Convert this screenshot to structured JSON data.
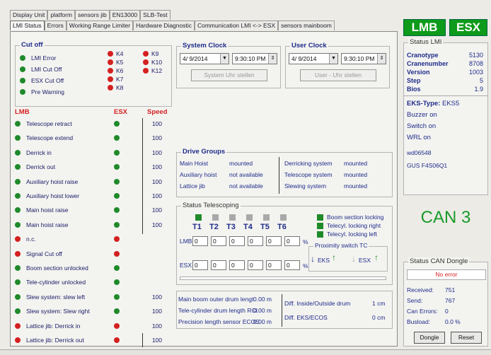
{
  "tabs_top": [
    "Display Unit",
    "platform",
    "sensors jib",
    "EN13000",
    "SLB-Test"
  ],
  "tabs_bottom": [
    "LMI Status",
    "Errors",
    "Working Range Limiter",
    "Hardware Diagnostic",
    "Communication LMI <-> ESX",
    "sensors mainboom"
  ],
  "cutoff": {
    "title": "Cut off",
    "items": [
      {
        "label": "LMI Error",
        "color": "green"
      },
      {
        "label": "LMI Cut Off",
        "color": "green"
      },
      {
        "label": "ESX Cut Off",
        "color": "green"
      },
      {
        "label": "Pre Warning",
        "color": "green"
      }
    ],
    "codes_left": [
      "K4",
      "K5",
      "K6",
      "K7",
      "K8"
    ],
    "codes_right": [
      "K9",
      "K10",
      "K12"
    ]
  },
  "lmb": {
    "col_lmb": "LMB",
    "col_esx": "ESX",
    "col_speed": "Speed",
    "rows": [
      {
        "label": "Telescope retract",
        "lmb": "green",
        "esx": "green",
        "speed": "100"
      },
      {
        "label": "Telescope extend",
        "lmb": "green",
        "esx": "green",
        "speed": "100"
      },
      {
        "label": "Derrick in",
        "lmb": "green",
        "esx": "green",
        "speed": "100"
      },
      {
        "label": "Derrick out",
        "lmb": "green",
        "esx": "green",
        "speed": "100"
      },
      {
        "label": "Auxiliary hoist raise",
        "lmb": "green",
        "esx": "green",
        "speed": "100"
      },
      {
        "label": "Auxiliary hoist lower",
        "lmb": "green",
        "esx": "green",
        "speed": "100"
      },
      {
        "label": "Main hoist raise",
        "lmb": "green",
        "esx": "green",
        "speed": "100"
      },
      {
        "label": "Main hoist raise",
        "lmb": "green",
        "esx": "green",
        "speed": "100"
      },
      {
        "label": "n.c.",
        "lmb": "red",
        "esx": "red",
        "speed": ""
      },
      {
        "label": "Signal Cut off",
        "lmb": "red",
        "esx": "red",
        "speed": ""
      },
      {
        "label": "Boom section unlocked",
        "lmb": "green",
        "esx": "green",
        "speed": ""
      },
      {
        "label": "Tele-cylinder unlocked",
        "lmb": "green",
        "esx": "green",
        "speed": ""
      },
      {
        "label": "Slew system: slew left",
        "lmb": "green",
        "esx": "green",
        "speed": "100"
      },
      {
        "label": "Slew system: Slew right",
        "lmb": "green",
        "esx": "green",
        "speed": "100"
      },
      {
        "label": "Lattice jib: Derrick in",
        "lmb": "red",
        "esx": "red",
        "speed": "100"
      },
      {
        "label": "Lattice jib: Derrick out",
        "lmb": "red",
        "esx": "red",
        "speed": "100"
      }
    ]
  },
  "system_clock": {
    "title": "System Clock",
    "date": "4/ 9/2014",
    "time": "9:30:10 PM",
    "button": "System Uhr stellen"
  },
  "user_clock": {
    "title": "User Clock",
    "date": "4/ 9/2014",
    "time": "9:30:10 PM",
    "button": "User - Uhr stellen"
  },
  "drive_groups": {
    "title": "Drive Groups",
    "left": [
      {
        "label": "Main Hoist",
        "value": "mounted"
      },
      {
        "label": "Auxiliary hoist",
        "value": "not available"
      },
      {
        "label": "Lattice jib",
        "value": "not available"
      }
    ],
    "right": [
      {
        "label": "Derricking system",
        "value": "mounted"
      },
      {
        "label": "Telescope system",
        "value": "mounted"
      },
      {
        "label": "Slewing system",
        "value": "mounted"
      }
    ]
  },
  "status_telescoping": {
    "title": "Status Telescoping",
    "sections": [
      "T1",
      "T2",
      "T3",
      "T4",
      "T5",
      "T6"
    ],
    "lmb_label": "LMB",
    "esx_label": "ESX",
    "lmb_values": [
      "0",
      "0",
      "0",
      "0",
      "0",
      "0"
    ],
    "esx_values": [
      "0",
      "0",
      "0",
      "0",
      "0",
      "0"
    ],
    "unit": "%",
    "locks": [
      "Boom section locking",
      "Telecyl. locking right",
      "Telecyl. locking left"
    ],
    "proximity_title": "Proximity switch TC",
    "prox_eks": "EKS",
    "prox_esx": "ESX"
  },
  "drums": [
    {
      "label": "Main boom outer drum lengt",
      "value": "0.00 m"
    },
    {
      "label": "Tele-cylinder drum length RCI",
      "value": "0.00 m"
    },
    {
      "label": "Precision length sensor ECOS",
      "value": "0.00 m"
    }
  ],
  "diffs": [
    {
      "label": "Diff. Inside/Outside drum",
      "value": "1 cm"
    },
    {
      "label": "Diff. EKS/ECOS",
      "value": "0 cm"
    }
  ],
  "buttons_top": {
    "lmb": "LMB",
    "esx": "ESX"
  },
  "status_lmi": {
    "title": "Status LMI",
    "rows": [
      {
        "label": "Cranotype",
        "value": "5130"
      },
      {
        "label": "Cranenumber",
        "value": "8708"
      },
      {
        "label": "Version",
        "value": "1003"
      },
      {
        "label": "Step",
        "value": "5"
      },
      {
        "label": "Bios",
        "value": "1.9"
      }
    ],
    "eks_type_label": "EKS-Type:",
    "eks_type_value": "EKS5",
    "lines": [
      "Buzzer on",
      "Switch on",
      "WRL on",
      "wd06548",
      "GUS F4S06Q1"
    ]
  },
  "can": {
    "label": "CAN 3"
  },
  "can_dongle": {
    "title": "Status CAN Dongle",
    "status": "No error",
    "rows": [
      {
        "label": "Received:",
        "value": "751"
      },
      {
        "label": "Send:",
        "value": "767"
      },
      {
        "label": "Can Errors:",
        "value": "0"
      },
      {
        "label": "Busload:",
        "value": "0.0 %"
      }
    ],
    "dongle_btn": "Dongle",
    "reset_btn": "Reset"
  },
  "colors": {
    "green": "#1f8a2a",
    "red": "#d42020",
    "accent_green": "#0e9a1a",
    "label_blue": "#1f2c8a"
  }
}
